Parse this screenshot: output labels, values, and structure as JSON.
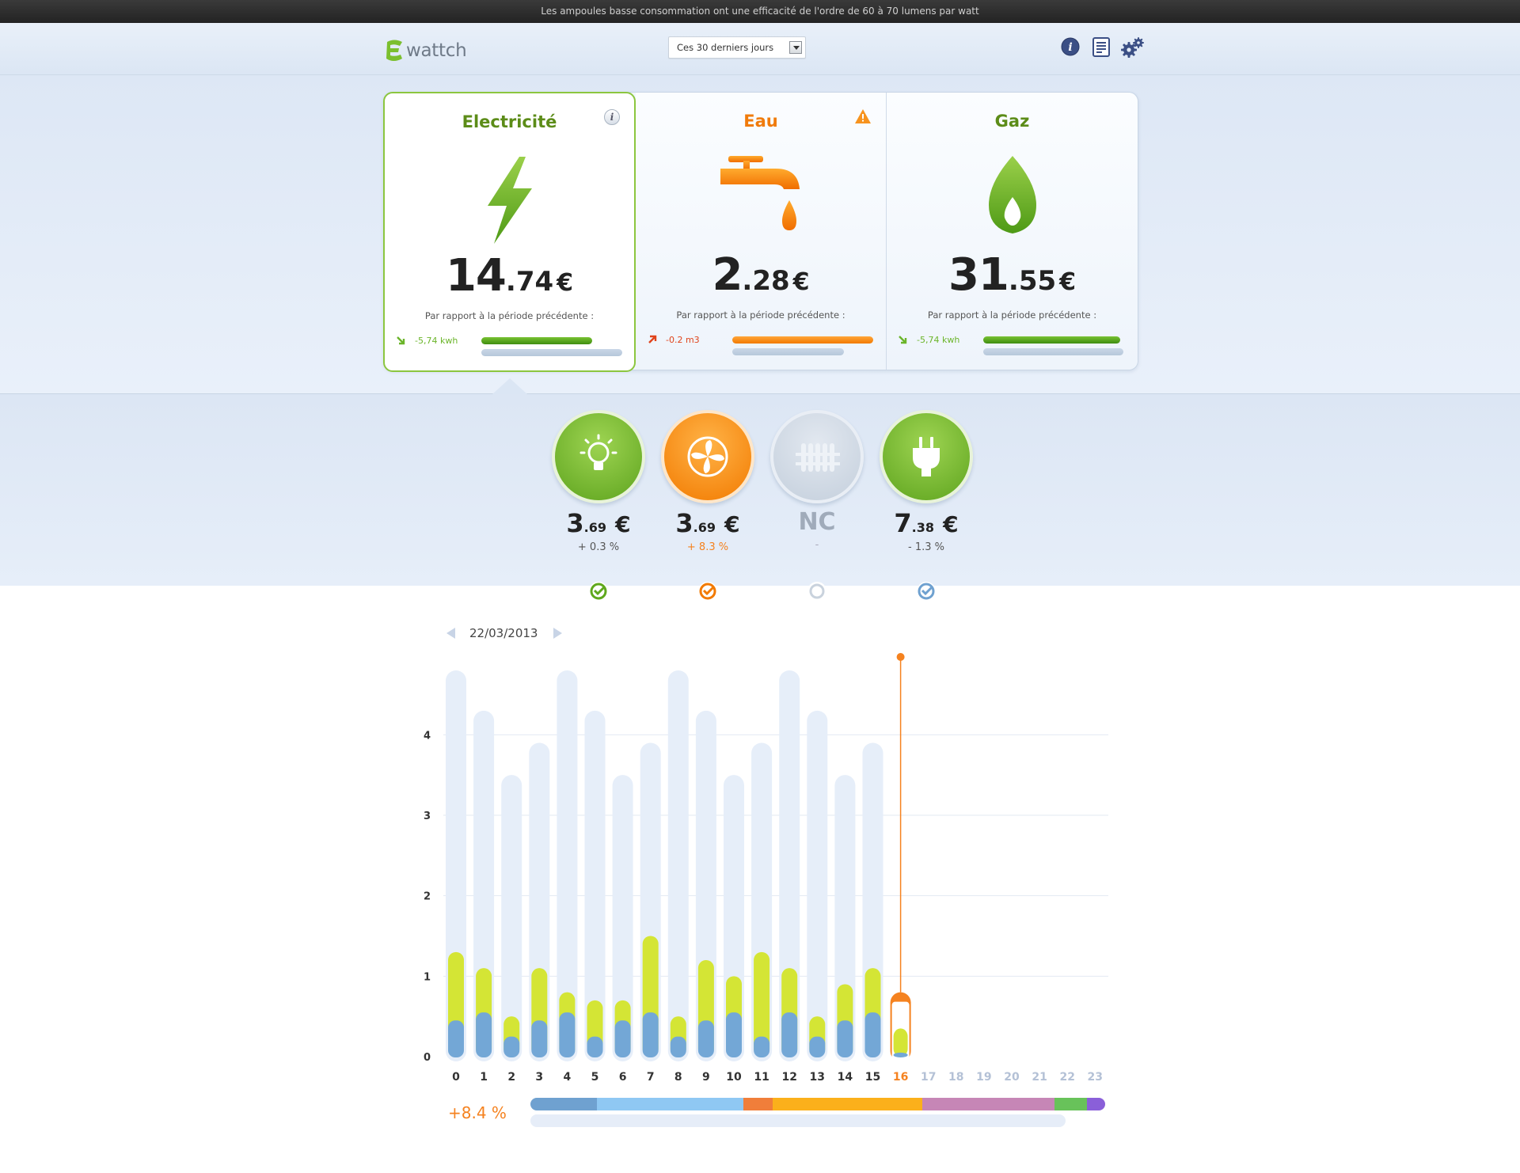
{
  "tip": "Les ampoules basse consommation ont une efficacité de l'ordre de 60 à 70 lumens par watt",
  "logo": {
    "text": "wattch"
  },
  "period": {
    "selected": "Ces 30 derniers jours"
  },
  "header_icons": [
    "info-icon",
    "report-icon",
    "settings-gears-icon"
  ],
  "cards": [
    {
      "title": "Electricité",
      "title_color": "#5c8c18",
      "int": "14",
      "dec": ".74",
      "cur": "€",
      "sub": "Par rapport à la période précédente :",
      "trend": "-5,74 kwh",
      "trend_color": "#6bb52a",
      "trend_direction": "down",
      "bar_color": "#5fa81d",
      "bar_now": 0.78,
      "bar_prev": 1.0,
      "badge": "info"
    },
    {
      "title": "Eau",
      "title_color": "#f07b0b",
      "int": "2",
      "dec": ".28",
      "cur": "€",
      "sub": "Par rapport à la période précédente :",
      "trend": "-0.2 m3",
      "trend_color": "#e0441c",
      "trend_direction": "up",
      "bar_color": "#f7931e",
      "bar_now": 1.0,
      "bar_prev": 0.79,
      "badge": "warning"
    },
    {
      "title": "Gaz",
      "title_color": "#5c8c18",
      "int": "31",
      "dec": ".55",
      "cur": "€",
      "sub": "Par rapport à la période précédente :",
      "trend": "-5,74 kwh",
      "trend_color": "#6bb52a",
      "trend_direction": "down",
      "bar_color": "#5fa81d",
      "bar_now": 1.0,
      "bar_prev": 1.0,
      "badge": ""
    }
  ],
  "devices": [
    {
      "name": "lightbulb-icon",
      "color": "#7bbf2e",
      "int": "3",
      "dec": ".69",
      "cur": "€",
      "pct": "+ 0.3 %",
      "pct_color": "#555",
      "check": "green"
    },
    {
      "name": "fan-icon",
      "color": "#f7931e",
      "int": "3",
      "dec": ".69",
      "cur": "€",
      "pct": "+ 8.3 %",
      "pct_color": "#f5821f",
      "check": "orange"
    },
    {
      "name": "radiator-icon",
      "color": "#cfd8e4",
      "nc": "NC",
      "pct": "-",
      "pct_color": "#aab",
      "check": "empty"
    },
    {
      "name": "plug-icon",
      "color": "#7bbf2e",
      "int": "7",
      "dec": ".38",
      "cur": "€",
      "pct": "- 1.3 %",
      "pct_color": "#555",
      "check": "blue"
    }
  ],
  "chart_date": "22/03/2013",
  "chart_data": {
    "type": "bar",
    "title": "",
    "x": [
      0,
      1,
      2,
      3,
      4,
      5,
      6,
      7,
      8,
      9,
      10,
      11,
      12,
      13,
      14,
      15,
      16,
      17,
      18,
      19,
      20,
      21,
      22,
      23
    ],
    "ylim": [
      0,
      4.8
    ],
    "yticks": [
      0,
      1,
      2,
      3,
      4
    ],
    "current_hour": 16,
    "series": [
      {
        "values": [
          4.8,
          4.3,
          3.5,
          3.9,
          4.8,
          4.3,
          3.5,
          3.9,
          4.8,
          4.3,
          3.5,
          3.9,
          4.8,
          4.3,
          3.5,
          3.9,
          0.8,
          null,
          null,
          null,
          null,
          null,
          null,
          null
        ]
      },
      {
        "values": [
          1.3,
          1.1,
          0.5,
          1.1,
          0.8,
          0.7,
          0.7,
          1.5,
          0.5,
          1.2,
          1.0,
          1.3,
          1.1,
          0.5,
          0.9,
          1.1,
          0.35,
          null,
          null,
          null,
          null,
          null,
          null,
          null
        ]
      },
      {
        "values": [
          0.45,
          0.55,
          0.25,
          0.45,
          0.55,
          0.25,
          0.45,
          0.55,
          0.25,
          0.45,
          0.55,
          0.25,
          0.55,
          0.25,
          0.45,
          0.55,
          0.05,
          null,
          null,
          null,
          null,
          null,
          null,
          null
        ]
      }
    ]
  },
  "summary": {
    "pct": "+8.4 %",
    "segments": [
      {
        "color": "#6fa1d0",
        "fraction": 0.116
      },
      {
        "color": "#8fc8f3",
        "fraction": 0.255
      },
      {
        "color": "#f07e3a",
        "fraction": 0.051
      },
      {
        "color": "#fbb01b",
        "fraction": 0.26
      },
      {
        "color": "#c686b6",
        "fraction": 0.23
      },
      {
        "color": "#68c25a",
        "fraction": 0.057
      },
      {
        "color": "#8a5fd9",
        "fraction": 0.031
      }
    ]
  }
}
